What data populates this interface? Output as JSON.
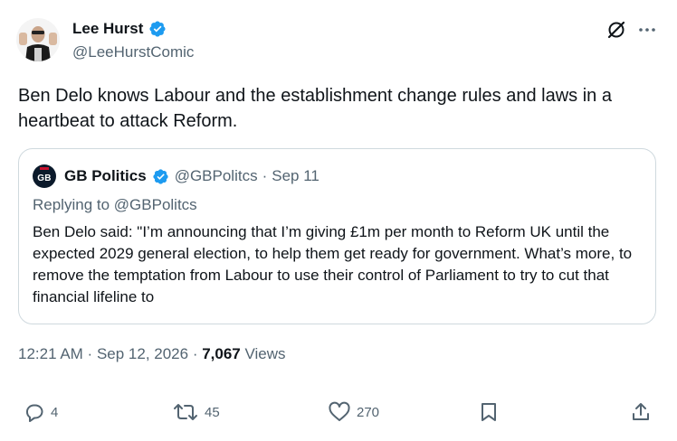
{
  "author": {
    "name": "Lee Hurst",
    "handle": "@LeeHurstComic"
  },
  "tweet": {
    "text": "Ben Delo knows Labour and the establishment change rules and laws in a heartbeat to attack Reform."
  },
  "quoted": {
    "avatar_text": "GB",
    "name": "GB Politics",
    "handle": "@GBPolitcs",
    "separator": "·",
    "date": "Sep 11",
    "replying_prefix": "Replying to ",
    "replying_handle": "@GBPolitcs",
    "text": "Ben Delo said: \"I’m announcing that I’m giving £1m per month to Reform UK until the expected 2029 general election, to help them get ready for government. What’s more, to remove the temptation from Labour to use their control of Parliament to try to cut that financial lifeline to"
  },
  "meta": {
    "time": "12:21 AM",
    "sep1": " · ",
    "date": "Sep 12, 2026",
    "sep2": " · ",
    "views_count": "7,067",
    "views_label": " Views"
  },
  "actions": {
    "replies": "4",
    "reposts": "45",
    "likes": "270"
  },
  "colors": {
    "verified": "#1d9bf0",
    "secondary_text": "#536471",
    "primary_text": "#0f1419",
    "border": "#cfd9de"
  },
  "icons": [
    "verified-badge-icon",
    "grok-icon",
    "more-icon",
    "reply-icon",
    "repost-icon",
    "like-icon",
    "bookmark-icon",
    "share-icon"
  ]
}
